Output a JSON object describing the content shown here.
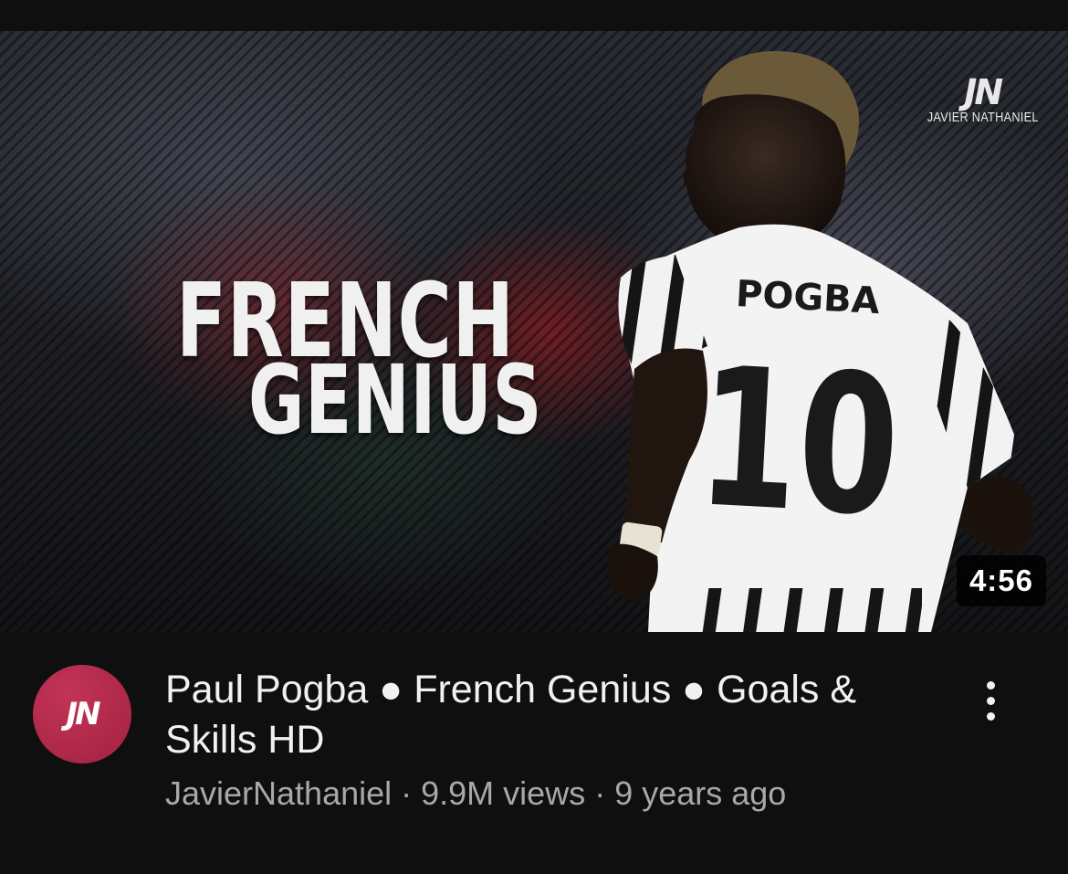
{
  "thumbnail": {
    "title_line1": "FRENCH",
    "title_line2": "GENIUS",
    "watermark_logo": "JN",
    "watermark_name": "JAVIER NATHANIEL",
    "jersey_name": "POGBA",
    "jersey_number": "10",
    "duration": "4:56"
  },
  "video": {
    "title": "Paul Pogba ● French Genius ● Goals & Skills HD",
    "channel": "JavierNathaniel",
    "views": "9.9M views",
    "age": "9 years ago",
    "separator": " · "
  },
  "channel_avatar": {
    "initials": "JN",
    "color": "#b02a4a"
  },
  "icons": {
    "menu": "more-vert-icon"
  }
}
